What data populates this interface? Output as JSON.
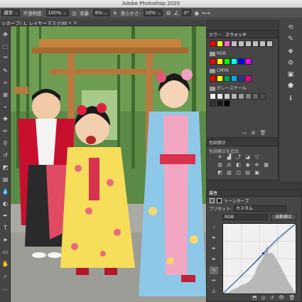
{
  "window": {
    "title": "Adobe Photoshop 2020"
  },
  "options_bar": {
    "mode_value": "通常",
    "opacity_label": "不透明度:",
    "opacity_value": "100%",
    "flow_label": "流量:",
    "flow_value": "6%",
    "smoothing_label": "滑らかさ:",
    "smoothing_value": "10%",
    "angle_value": "0°"
  },
  "document_tab": {
    "label": "シカーブ) 1, レイヤーマスク/8) *",
    "close": "×"
  },
  "tools": [
    {
      "name": "move-tool",
      "glyph": "✥"
    },
    {
      "name": "marquee-tool",
      "glyph": "⬚"
    },
    {
      "name": "lasso-tool",
      "glyph": "ᕯ"
    },
    {
      "name": "quick-select-tool",
      "glyph": "✎"
    },
    {
      "name": "crop-tool",
      "glyph": "⌗"
    },
    {
      "name": "frame-tool",
      "glyph": "⊠"
    },
    {
      "name": "eyedropper-tool",
      "glyph": "⌁"
    },
    {
      "name": "healing-tool",
      "glyph": "✚"
    },
    {
      "name": "brush-tool",
      "glyph": "✏"
    },
    {
      "name": "stamp-tool",
      "glyph": "⚲"
    },
    {
      "name": "history-brush-tool",
      "glyph": "↺"
    },
    {
      "name": "eraser-tool",
      "glyph": "◩"
    },
    {
      "name": "gradient-tool",
      "glyph": "▤"
    },
    {
      "name": "blur-tool",
      "glyph": "💧"
    },
    {
      "name": "dodge-tool",
      "glyph": "◐"
    },
    {
      "name": "pen-tool",
      "glyph": "✒"
    },
    {
      "name": "type-tool",
      "glyph": "T"
    },
    {
      "name": "path-select-tool",
      "glyph": "➤"
    },
    {
      "name": "shape-tool",
      "glyph": "▭"
    },
    {
      "name": "hand-tool",
      "glyph": "✋"
    },
    {
      "name": "zoom-tool",
      "glyph": "⌕"
    },
    {
      "name": "more-tools",
      "glyph": "…"
    }
  ],
  "swatches_panel": {
    "tab_color": "カラー",
    "tab_swatches": "スウォッチ",
    "recent_colors": [
      "#ff0000",
      "#ffff00",
      "#ff66cc",
      "#bfbfbf",
      "#bfbfbf",
      "#bfbfbf",
      "#bfbfbf",
      "#bfbfbf",
      "#bfbfbf"
    ],
    "groups": [
      {
        "label": "RGB",
        "colors": [
          "#ff0000",
          "#ffff00",
          "#00ff00",
          "#00ffff",
          "#0000ff",
          "#ff00ff"
        ]
      },
      {
        "label": "CMYK",
        "colors": [
          "#ff0000",
          "#ffff00",
          "#00a651",
          "#00aeef",
          "#2e3192",
          "#ec008c"
        ]
      },
      {
        "label": "グレースケール",
        "colors": [
          "#ffffff",
          "#e6e6e6",
          "#cccccc",
          "#b3b3b3",
          "#999999",
          "#808080",
          "#666666",
          "#4d4d4d",
          "#333333",
          "#1a1a1a",
          "#000000"
        ]
      }
    ]
  },
  "adjustments_panel": {
    "title": "色調補正",
    "subtitle": "色調補正を追加"
  },
  "properties_panel": {
    "tab": "属性",
    "adjustment_name": "トーンカーブ",
    "preset_label": "プリセット:",
    "preset_value": "カスタム",
    "channel_value": "RGB",
    "auto_button": "自動補正"
  }
}
